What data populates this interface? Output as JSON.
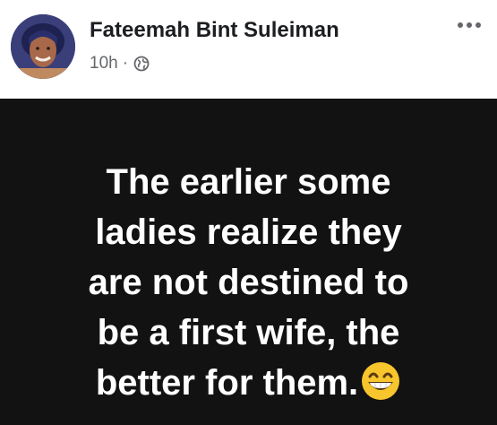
{
  "post": {
    "author": "Fateemah Bint Suleiman",
    "timestamp": "10h",
    "separator": "·",
    "privacy_icon": "globe-icon",
    "more_icon": "more-horizontal-icon",
    "text_lines": [
      "The earlier some",
      "ladies realize they",
      "are not destined to",
      "be a first wife, the",
      "better for them."
    ],
    "emoji": "grinning-face-with-smiling-eyes-icon",
    "background_color": "#121212",
    "text_color": "#ffffff"
  }
}
